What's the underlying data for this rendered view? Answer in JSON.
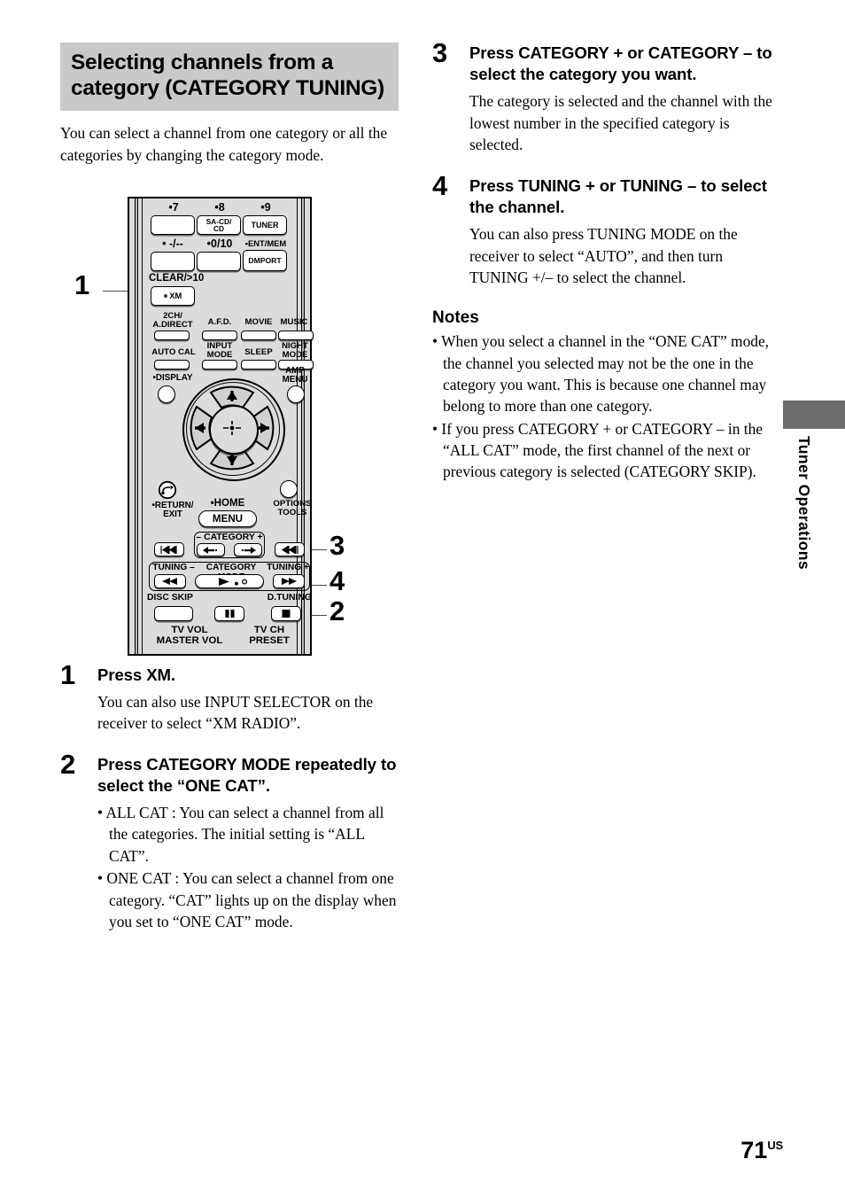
{
  "section": {
    "heading": "Selecting channels from a category (CATEGORY TUNING)",
    "intro": "You can select a channel from one category or all the categories by changing the category mode."
  },
  "steps": [
    {
      "num": "1",
      "title": "Press XM.",
      "text": "You can also use INPUT SELECTOR on the receiver to select “XM RADIO”."
    },
    {
      "num": "2",
      "title": "Press CATEGORY MODE repeatedly to select the “ONE CAT”.",
      "bullets": [
        "• ALL CAT : You can select a channel from all the categories. The initial setting is “ALL CAT”.",
        "• ONE CAT : You can select a channel from one category. “CAT” lights up on the display when you set to “ONE CAT” mode."
      ]
    },
    {
      "num": "3",
      "title": "Press CATEGORY + or CATEGORY – to select the category you want.",
      "text": "The category is selected and the channel with the lowest number in the specified category is selected."
    },
    {
      "num": "4",
      "title": "Press TUNING + or TUNING – to select the channel.",
      "text": "You can also press TUNING MODE on the receiver to select “AUTO”, and then turn TUNING +/– to select the channel."
    }
  ],
  "notes": {
    "heading": "Notes",
    "items": [
      "• When you select a channel in the “ONE CAT” mode, the channel you selected may not be the one in the category you want. This is because one channel may belong to more than one category.",
      "• If you press CATEGORY + or CATEGORY – in the “ALL CAT” mode, the first channel of the next or previous category is selected (CATEGORY SKIP)."
    ]
  },
  "side_tab": {
    "label": "Tuner Operations",
    "color": "#6d6d6d"
  },
  "page_number": {
    "number": "71",
    "suffix": "US"
  },
  "figure": {
    "callouts": [
      "1",
      "3",
      "4",
      "2"
    ],
    "remote": {
      "num_row_labels": {
        "seven": "•7",
        "eight": "•8",
        "nine": "•9"
      },
      "b_seven": "",
      "b_sacd": "SA-CD/\nCD",
      "b_tuner": "TUNER",
      "num_row2_labels": {
        "dash": "• -/--",
        "zero": "•0/10",
        "ent": "•ENT/MEM"
      },
      "b_dmport": "DMPORT",
      "clear_label": "CLEAR/>10",
      "b_xm": "XM",
      "mode_labels": {
        "two_ch": "2CH/\nA.DIRECT",
        "afd": "A.F.D.",
        "movie": "MOVIE",
        "music": "MUSIC",
        "auto_cal": "AUTO CAL",
        "input_mode": "INPUT\nMODE",
        "sleep": "SLEEP",
        "night_mode": "NIGHT\nMODE"
      },
      "display_label": "•DISPLAY",
      "amp_menu_label": "AMP\nMENU",
      "return_label": "•RETURN/\nEXIT",
      "home_label": "•HOME",
      "menu_label": "MENU",
      "options_label": "OPTIONS\nTOOLS",
      "category_label": "– CATEGORY +",
      "tuning_minus_label": "TUNING –",
      "category_mode_label": "CATEGORY MODE",
      "tuning_plus_label": "TUNING +",
      "disc_skip_label": "DISC SKIP",
      "d_tuning_label": "D.TUNING",
      "tv_vol_label": "TV VOL\nMASTER VOL",
      "tv_ch_label": "TV CH\nPRESET"
    }
  }
}
